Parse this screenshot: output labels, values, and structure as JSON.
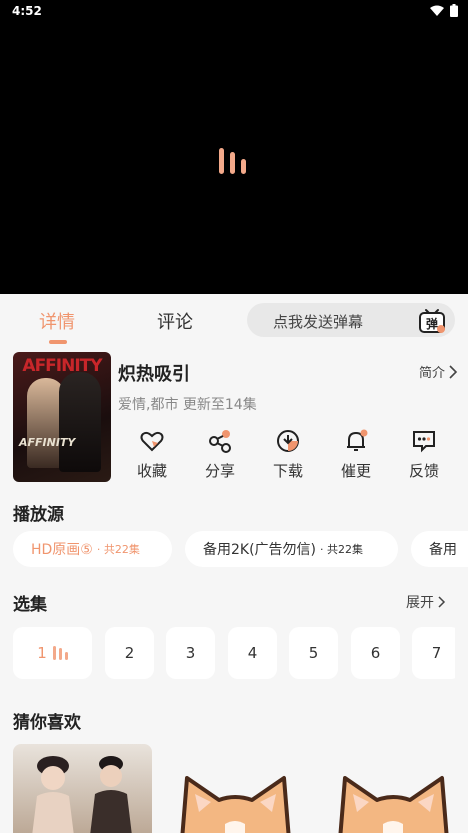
{
  "status_bar": {
    "time": "4:52",
    "icons": [
      "wifi-icon",
      "battery-icon"
    ]
  },
  "player": {
    "state": "loading"
  },
  "tabs": {
    "details": "详情",
    "comments": "评论",
    "active": "details"
  },
  "danmu": {
    "placeholder": "点我发送弹幕",
    "icon_label": "弹"
  },
  "show": {
    "title": "炽热吸引",
    "intro_label": "简介",
    "meta": "爱情,都市 更新至14集",
    "poster_title": "AFFINITY",
    "poster_logo": "AFFINITY"
  },
  "actions": [
    {
      "label": "收藏",
      "icon": "heart-icon"
    },
    {
      "label": "分享",
      "icon": "share-icon"
    },
    {
      "label": "下载",
      "icon": "download-icon"
    },
    {
      "label": "催更",
      "icon": "bell-icon"
    },
    {
      "label": "反馈",
      "icon": "feedback-icon"
    }
  ],
  "sources": {
    "heading": "播放源",
    "items": [
      {
        "name": "HD原画⑤",
        "count": "· 共22集",
        "active": true
      },
      {
        "name": "备用2K(广告勿信)",
        "count": "· 共22集",
        "active": false
      },
      {
        "name": "备用",
        "count": "",
        "active": false
      }
    ]
  },
  "episodes": {
    "heading": "选集",
    "expand_label": "展开",
    "items": [
      "1",
      "2",
      "3",
      "4",
      "5",
      "6",
      "7"
    ],
    "playing": "1"
  },
  "recommend": {
    "heading": "猜你喜欢"
  },
  "colors": {
    "accent": "#f0956e",
    "background": "#f6f6f6",
    "player": "#000000"
  }
}
